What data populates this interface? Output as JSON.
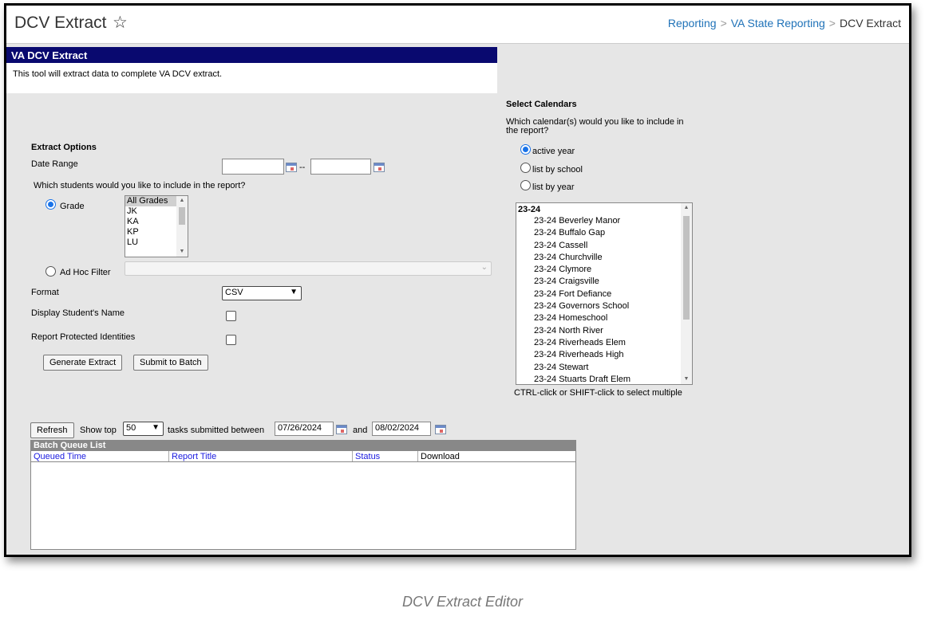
{
  "header": {
    "title": "DCV Extract",
    "breadcrumb": [
      "Reporting",
      "VA State Reporting",
      "DCV Extract"
    ]
  },
  "panel": {
    "title": "VA DCV Extract",
    "description": "This tool will extract data to complete VA DCV extract."
  },
  "extract_options": {
    "heading": "Extract Options",
    "date_range_label": "Date Range",
    "date_start": "",
    "date_end": "",
    "date_separator": "--",
    "students_question": "Which students would you like to include in the report?",
    "grade_label": "Grade",
    "grade_selected": true,
    "grades": [
      "All Grades",
      "JK",
      "KA",
      "KP",
      "LU"
    ],
    "adhoc_label": "Ad Hoc Filter",
    "adhoc_value": "",
    "format_label": "Format",
    "format_value": "CSV",
    "display_name_label": "Display Student's Name",
    "display_name_checked": false,
    "protected_label": "Report Protected Identities",
    "protected_checked": false,
    "generate_button": "Generate Extract",
    "batch_button": "Submit to Batch"
  },
  "calendars": {
    "heading": "Select Calendars",
    "question": "Which calendar(s) would you like to include in the report?",
    "options": [
      "active year",
      "list by school",
      "list by year"
    ],
    "selected_option": "active year",
    "group": "23-24",
    "items": [
      "23-24 Beverley Manor",
      "23-24 Buffalo Gap",
      "23-24 Cassell",
      "23-24 Churchville",
      "23-24 Clymore",
      "23-24 Craigsville",
      "23-24 Fort Defiance",
      "23-24 Governors School",
      "23-24 Homeschool",
      "23-24 North River",
      "23-24 Riverheads Elem",
      "23-24 Riverheads High",
      "23-24 Stewart",
      "23-24 Stuarts Draft Elem"
    ],
    "hint": "CTRL-click or SHIFT-click to select multiple"
  },
  "batch": {
    "refresh_button": "Refresh",
    "show_top_label": "Show top",
    "show_top_value": "50",
    "between_label": "tasks submitted between",
    "start_date": "07/26/2024",
    "and_label": "and",
    "end_date": "08/02/2024",
    "queue_title": "Batch Queue List",
    "columns": [
      "Queued Time",
      "Report Title",
      "Status",
      "Download"
    ]
  },
  "caption": "DCV Extract Editor",
  "colors": {
    "header_bg": "#09096f",
    "link": "#1f72b8",
    "radio": "#1a73e8"
  }
}
